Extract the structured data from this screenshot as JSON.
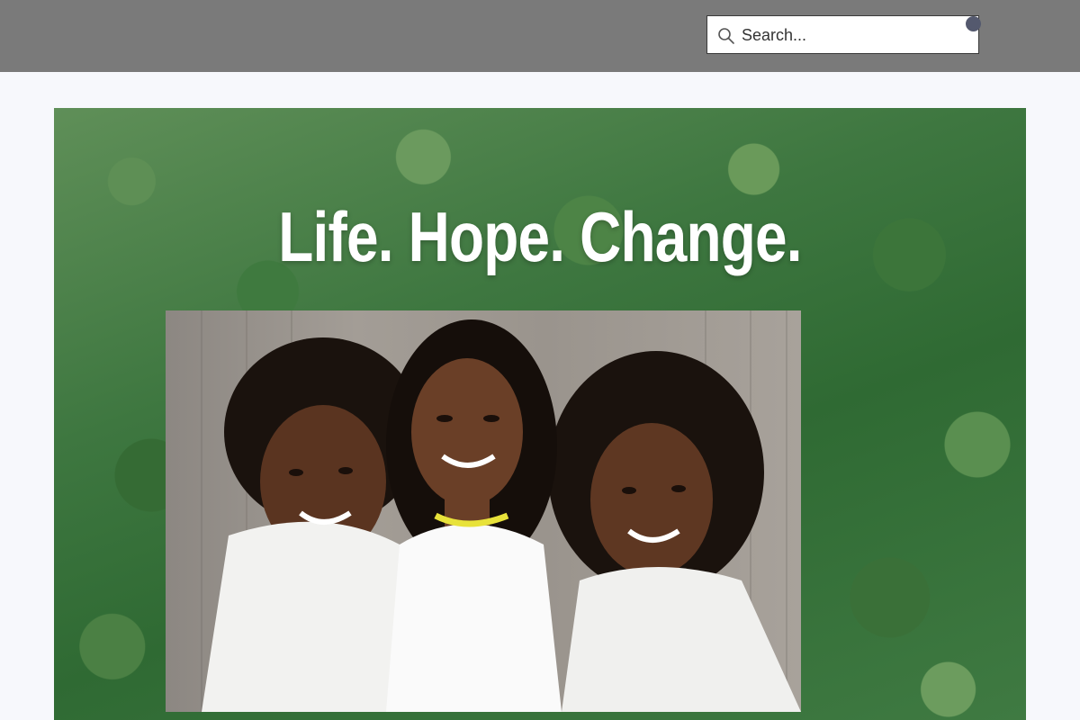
{
  "header": {
    "search": {
      "placeholder": "Search...",
      "icon": "search-icon"
    },
    "cart": {
      "icon": "basket-icon",
      "badge_color": "#54596e"
    },
    "background": "#7a7a7a"
  },
  "hero": {
    "title": "Life. Hope. Change.",
    "background_image": "forest-aerial",
    "photo": "three-women-smiling"
  }
}
